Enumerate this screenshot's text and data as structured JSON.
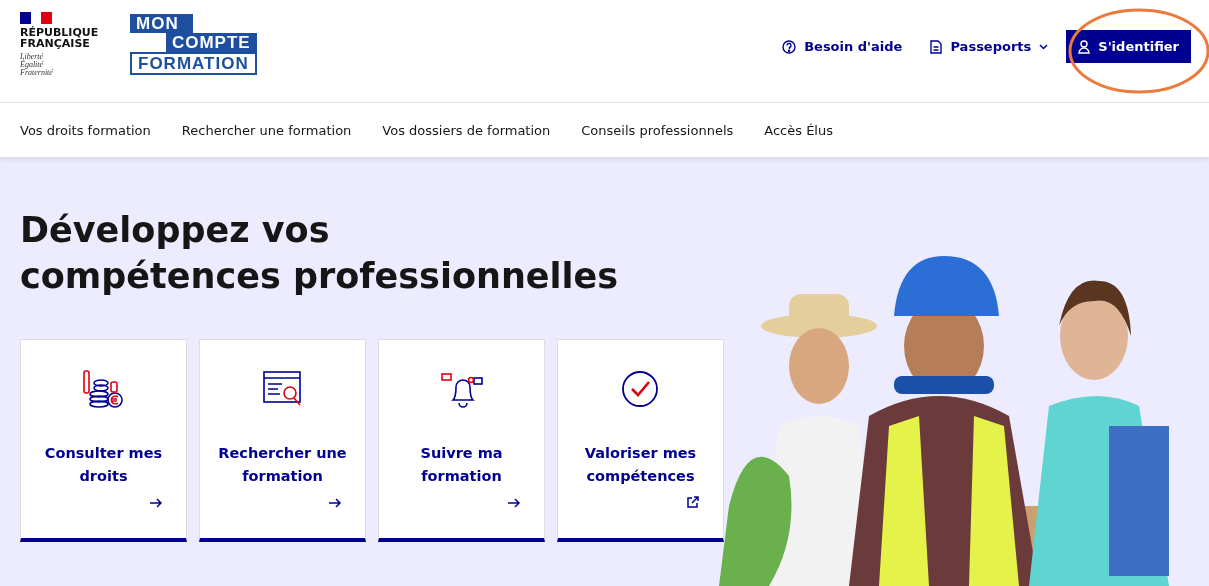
{
  "header": {
    "republic": {
      "name": [
        "RÉPUBLIQUE",
        "FRANÇAISE"
      ],
      "motto": [
        "Liberté",
        "Égalité",
        "Fraternité"
      ]
    },
    "logo": [
      "MON",
      "COMPTE",
      "FORMATION"
    ],
    "actions": [
      {
        "kind": "help",
        "label": "Besoin d'aide"
      },
      {
        "kind": "menu",
        "label": "Passeports"
      },
      {
        "kind": "login",
        "label": "S'identifier"
      }
    ]
  },
  "annotation": {
    "kind": "circle",
    "color": "#ec7a3c"
  },
  "nav": [
    {
      "label": "Vos droits formation"
    },
    {
      "label": "Rechercher une formation"
    },
    {
      "label": "Vos dossiers de formation"
    },
    {
      "label": "Conseils professionnels"
    },
    {
      "label": "Accès Élus"
    }
  ],
  "hero": {
    "title": [
      "Développez vos",
      "compétences professionnelles"
    ],
    "cards": [
      {
        "title": "Consulter mes droits",
        "kind": "internal"
      },
      {
        "title": "Rechercher une formation",
        "kind": "internal"
      },
      {
        "title": "Suivre ma formation",
        "kind": "internal"
      },
      {
        "title": "Valoriser mes compétences",
        "kind": "external"
      }
    ],
    "image": {
      "kind": "picture"
    }
  }
}
